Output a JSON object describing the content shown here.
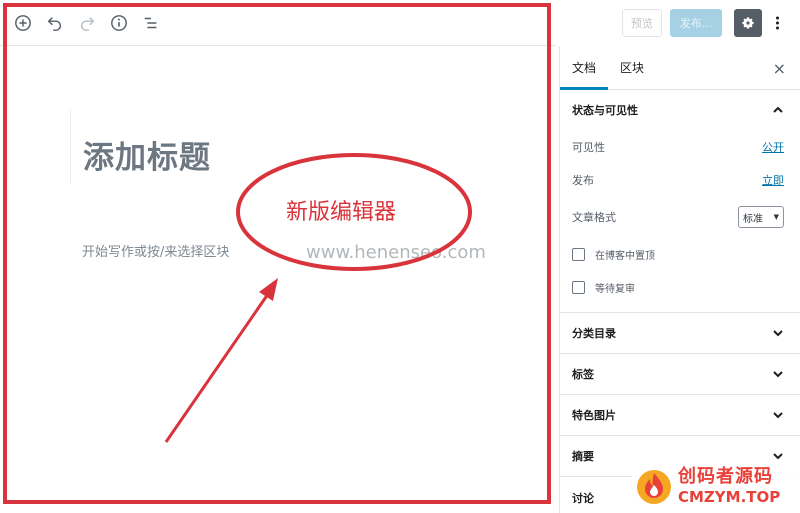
{
  "toolbar": {
    "icons": [
      "add-block-icon",
      "undo-icon",
      "redo-icon",
      "info-icon",
      "outline-icon"
    ]
  },
  "editor": {
    "title_placeholder": "添加标题",
    "body_placeholder": "开始写作或按/来选择区块"
  },
  "topbar": {
    "preview_label": "预览",
    "publish_label": "发布...",
    "settings_icon": "gear-icon",
    "more_icon": "more-vertical-icon"
  },
  "sidebar": {
    "tabs": [
      {
        "label": "文档",
        "active": true
      },
      {
        "label": "区块",
        "active": false
      }
    ],
    "close_label": "×",
    "status_panel": {
      "title": "状态与可见性",
      "visibility_label": "可见性",
      "visibility_value": "公开",
      "publish_label": "发布",
      "publish_value": "立即",
      "format_label": "文章格式",
      "format_value": "标准",
      "sticky_label": "在博客中置顶",
      "pending_label": "等待复审"
    },
    "panels": [
      {
        "title": "分类目录"
      },
      {
        "title": "标签"
      },
      {
        "title": "特色图片"
      },
      {
        "title": "摘要"
      },
      {
        "title": "讨论"
      }
    ]
  },
  "annotation": {
    "label": "新版编辑器",
    "color": "#d9343b"
  },
  "watermark": {
    "site": "www.henenseo.com"
  },
  "logo": {
    "cn": "创码者源码",
    "en": "CMZYM.TOP"
  },
  "colors": {
    "accent": "#0085ba",
    "link": "#0073aa",
    "annotation": "#d9343b"
  }
}
